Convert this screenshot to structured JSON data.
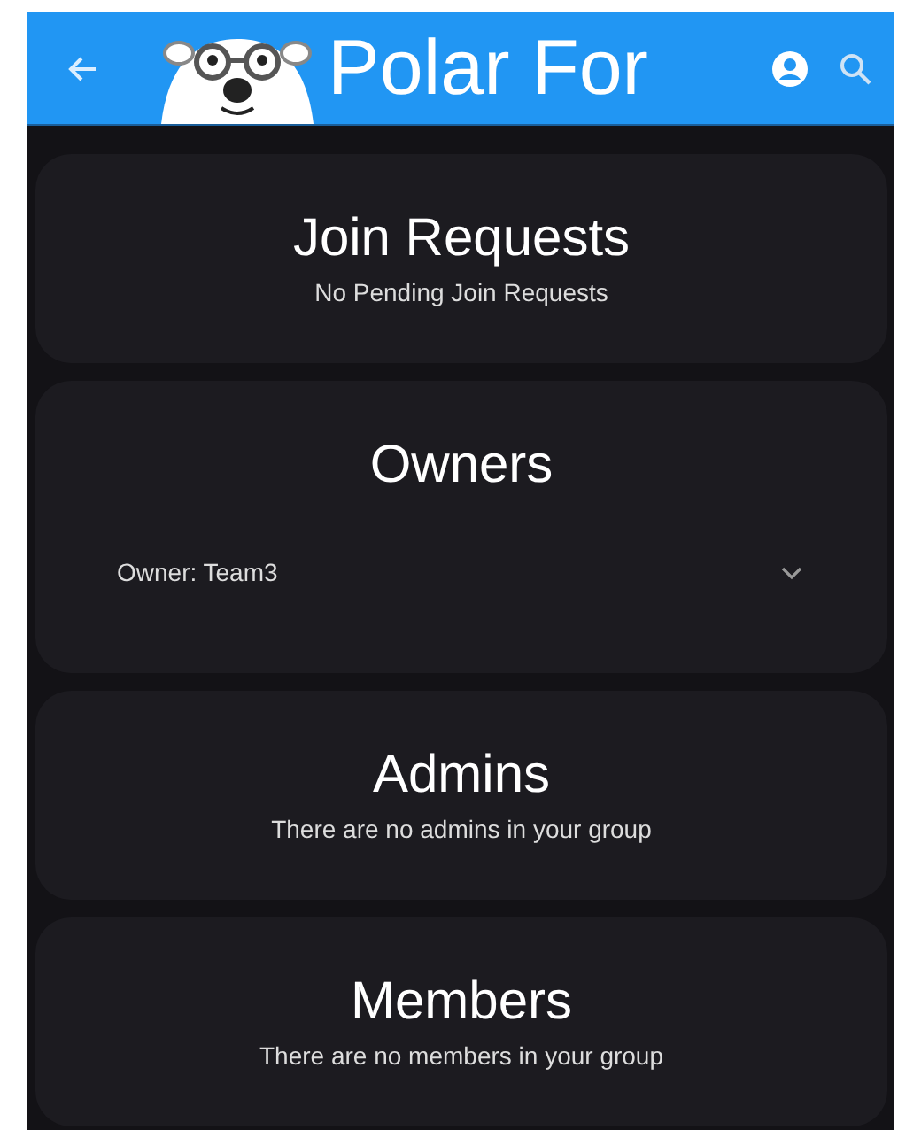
{
  "app_bar": {
    "title": "Polar For"
  },
  "sections": [
    {
      "kind": "message",
      "title": "Join Requests",
      "message": "No Pending Join Requests"
    },
    {
      "kind": "expansion",
      "title": "Owners",
      "entry": {
        "label": "Owner: Team3",
        "expanded": false
      }
    },
    {
      "kind": "message",
      "title": "Admins",
      "message": "There are no admins in your group"
    },
    {
      "kind": "message",
      "title": "Members",
      "message": "There are no members in your group"
    }
  ]
}
